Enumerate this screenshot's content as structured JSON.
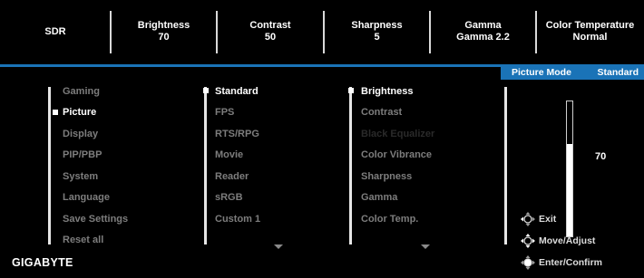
{
  "status_bar": [
    {
      "line1": "SDR",
      "line2": ""
    },
    {
      "line1": "Brightness",
      "line2": "70"
    },
    {
      "line1": "Contrast",
      "line2": "50"
    },
    {
      "line1": "Sharpness",
      "line2": "5"
    },
    {
      "line1": "Gamma",
      "line2": "Gamma 2.2"
    },
    {
      "line1": "Color Temperature",
      "line2": "Normal"
    }
  ],
  "mode_tab": {
    "label": "Picture Mode",
    "value": "Standard"
  },
  "main_menu": {
    "items": [
      "Gaming",
      "Picture",
      "Display",
      "PIP/PBP",
      "System",
      "Language",
      "Save Settings",
      "Reset all"
    ],
    "selected": "Picture"
  },
  "picture_mode_menu": {
    "items": [
      "Standard",
      "FPS",
      "RTS/RPG",
      "Movie",
      "Reader",
      "sRGB",
      "Custom 1"
    ],
    "selected": "Standard"
  },
  "picture_settings_menu": {
    "items": [
      "Brightness",
      "Contrast",
      "Black Equalizer",
      "Color Vibrance",
      "Sharpness",
      "Gamma",
      "Color Temp."
    ],
    "selected": "Brightness",
    "disabled": "Black Equalizer"
  },
  "slider": {
    "value": "70",
    "level": 0.7
  },
  "help": [
    {
      "icon": "dpad-icon",
      "label": "Exit"
    },
    {
      "icon": "dpad-icon",
      "label": "Move/Adjust"
    },
    {
      "icon": "dpad-icon",
      "label": "Enter/Confirm"
    }
  ],
  "brand": "GIGABYTE",
  "colors": {
    "accent": "#1a73b7",
    "background": "#000000",
    "dim_text": "#7d7d7d"
  }
}
